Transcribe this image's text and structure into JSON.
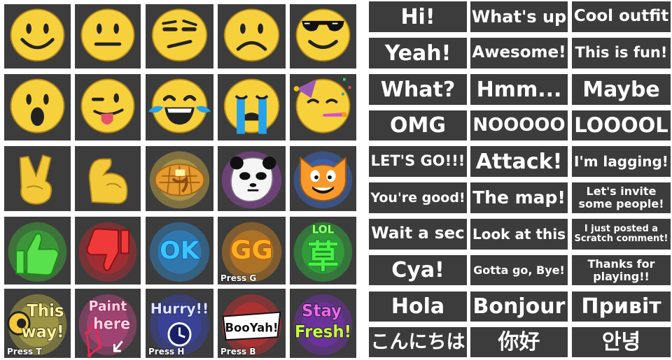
{
  "colors": {
    "cell_bg": "#3c3c3c",
    "grid_line": "#ffffff",
    "face_yellow": "#f7d13c",
    "face_outline": "#b0861a",
    "text_white": "#ffffff"
  },
  "emoji_panel": {
    "rows": [
      [
        {
          "icon": "smile-face-icon"
        },
        {
          "icon": "neutral-face-icon"
        },
        {
          "icon": "skeptical-face-icon"
        },
        {
          "icon": "frown-face-icon"
        },
        {
          "icon": "sunglasses-face-icon"
        }
      ],
      [
        {
          "icon": "shocked-face-icon"
        },
        {
          "icon": "tongue-out-face-icon"
        },
        {
          "icon": "laughing-tears-face-icon"
        },
        {
          "icon": "crying-face-icon"
        },
        {
          "icon": "party-face-icon"
        }
      ],
      [
        {
          "icon": "peace-hand-icon"
        },
        {
          "icon": "flexed-bicep-icon"
        },
        {
          "icon": "waffle-icon"
        },
        {
          "icon": "panda-icon"
        },
        {
          "icon": "scratch-cat-icon"
        }
      ],
      [
        {
          "icon": "thumbs-up-icon"
        },
        {
          "icon": "thumbs-down-icon"
        },
        {
          "icon": "ok-sticker-icon",
          "text": "OK"
        },
        {
          "icon": "gg-sticker-icon",
          "text": "GG",
          "hint": "Press G"
        },
        {
          "icon": "lol-kusa-sticker-icon",
          "text": "LOL",
          "text2": "草"
        }
      ],
      [
        {
          "icon": "this-way-sticker-icon",
          "text": "This",
          "text2": "way!",
          "hint": "Press T"
        },
        {
          "icon": "paint-here-sticker-icon",
          "text": "Paint",
          "text2": "here"
        },
        {
          "icon": "hurry-sticker-icon",
          "text": "Hurry!!",
          "hint": "Press H"
        },
        {
          "icon": "booyah-sticker-icon",
          "text": "BooYah!",
          "hint": "Press B"
        },
        {
          "icon": "stay-fresh-sticker-icon",
          "text": "Stay",
          "text2": "Fresh!"
        }
      ]
    ]
  },
  "phrase_panel": {
    "rows": [
      [
        "Hi!",
        "What's up",
        "Cool outfit"
      ],
      [
        "Yeah!",
        "Awesome!",
        "This is fun!"
      ],
      [
        "What?",
        "Hmm...",
        "Maybe"
      ],
      [
        "OMG",
        "NOOOOO",
        "LOOOOL"
      ],
      [
        "LET'S GO!!!",
        "Attack!",
        "I'm lagging!"
      ],
      [
        "You're good!",
        "The map!",
        "Let's invite\nsome people!"
      ],
      [
        "Wait a sec",
        "Look at this",
        "I just posted a\nScratch comment!"
      ],
      [
        "Cya!",
        "Gotta go, Bye!",
        "Thanks for\nplaying!!"
      ],
      [
        "Hola",
        "Bonjour",
        "Привіт"
      ],
      [
        "こんにちは",
        "你好",
        "안녕"
      ]
    ]
  }
}
